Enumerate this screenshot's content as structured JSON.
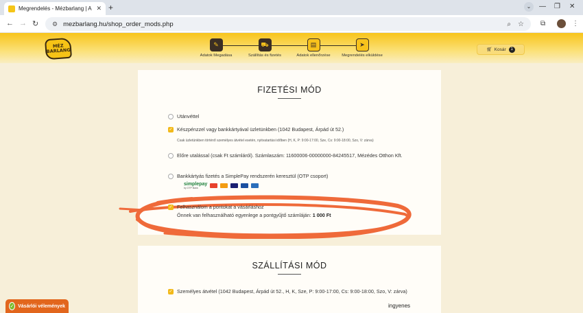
{
  "browser": {
    "tab_title": "Megrendelés - Mézbarlang | A",
    "tab_close": "✕",
    "new_tab": "+",
    "url": "mezbarlang.hu/shop_order_mods.php",
    "minimize": "—",
    "maximize": "❐",
    "close": "✕"
  },
  "site": {
    "logo_line1": "MÉZ",
    "logo_line2": "BARLANG",
    "steps": [
      {
        "label": "Adatok Megadása",
        "icon": "edit-icon",
        "state": "done"
      },
      {
        "label": "Szállítás és fizetés",
        "icon": "truck-icon",
        "state": "done"
      },
      {
        "label": "Adatok ellenőrzése",
        "icon": "clipboard-icon",
        "state": "pending"
      },
      {
        "label": "Megrendelés elküldése",
        "icon": "send-icon",
        "state": "pending"
      }
    ],
    "cart_label": "Kosár",
    "cart_count": "1"
  },
  "payment": {
    "title": "FIZETÉSI MÓD",
    "options": [
      {
        "label": "Utánvéttel",
        "checked": false
      },
      {
        "label": "Készpénzzel vagy bankkártyával üzletünkben (1042 Budapest, Árpád út 52.)",
        "checked": true
      },
      {
        "label": "Előre utalással (csak Ft számláról). Számlaszám: 11600006-00000000-84245517, Mézédes Otthon Kft.",
        "checked": false
      },
      {
        "label": "Bankkártyás fizetés a SimplePay rendszerén keresztül (OTP csoport)",
        "checked": false
      }
    ],
    "store_note": "Csak üzletünkben történő személyes átvétel esetén, nyitvatartási időben (H, K, P: 9:00-17:00, Sze, Cs: 9:00-18:00, Szo, V: zárva)",
    "simplepay_label": "simplepay",
    "simplepay_sub": "by OTP Bank",
    "points_label": "Felhasználom a pontokat a vásárláshoz",
    "points_info": "Önnek van felhasználható egyenlege a pontgyűjtő számláján:",
    "points_amount": "1 000 Ft"
  },
  "shipping": {
    "title": "SZÁLLÍTÁSI MÓD",
    "option": "Személyes átvétel (1042 Budapest, Árpád út 52., H, K, Sze, P: 9:00-17:00, Cs: 9:00-18:00, Szo, V: zárva)",
    "price": "ingyenes"
  },
  "reviews_badge": "Vásárlói vélemények",
  "colors": {
    "accent": "#f7c21c",
    "dark": "#3a2e24",
    "scribble": "#ef6a3a",
    "badge": "#e2661d"
  }
}
